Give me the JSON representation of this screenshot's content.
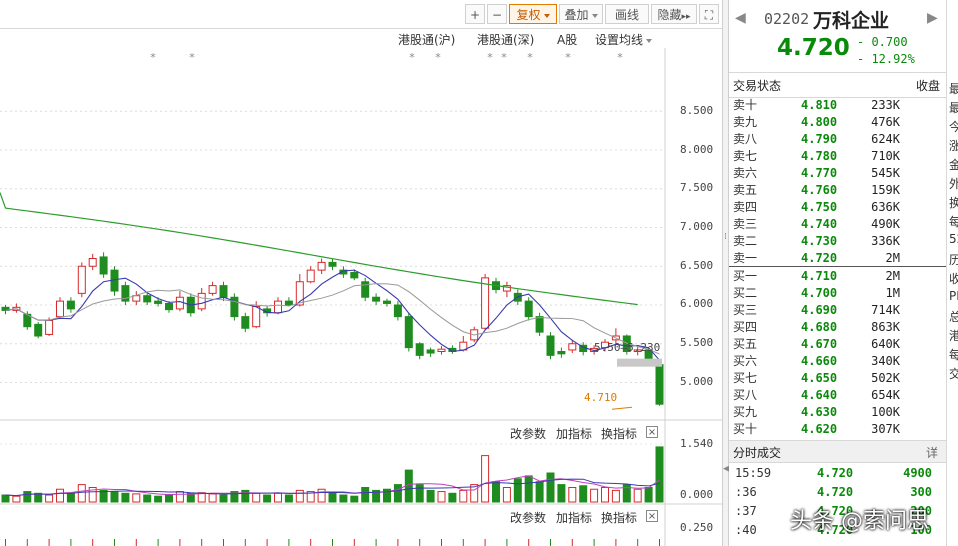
{
  "toolbar": {
    "plus": "+",
    "minus": "−",
    "adjust_label": "复权",
    "overlay_label": "叠加",
    "draw_label": "画线",
    "hide_label": "隐藏",
    "hide_arrows": "▸▸",
    "fullscreen": "⛶"
  },
  "subnav": {
    "items": [
      "港股通(沪)",
      "港股通(深)",
      "A股",
      "设置均线"
    ]
  },
  "price_axis": [
    "8.500",
    "8.000",
    "7.500",
    "7.000",
    "6.500",
    "6.000",
    "5.500",
    "5.000"
  ],
  "price_annotations": {
    "low_label": "4.710",
    "range_label": "5.50–5.230"
  },
  "volume_panel": {
    "buttons": [
      "改参数",
      "加指标",
      "换指标"
    ],
    "axis": [
      "1.540",
      "0.000"
    ]
  },
  "indicator_panel": {
    "buttons": [
      "改参数",
      "加指标",
      "换指标"
    ],
    "axis": [
      "0.250"
    ]
  },
  "close_glyph": "×",
  "quote": {
    "code": "02202",
    "name": "万科企业",
    "price": "4.720",
    "change": "- 0.700",
    "change_pct": "- 12.92%",
    "prev_arrow": "◀",
    "next_arrow": "▶"
  },
  "trade_status": {
    "label": "交易状态",
    "value": "收盘"
  },
  "order_book": {
    "asks": [
      {
        "label": "卖十",
        "price": "4.810",
        "volume": "233K"
      },
      {
        "label": "卖九",
        "price": "4.800",
        "volume": "476K"
      },
      {
        "label": "卖八",
        "price": "4.790",
        "volume": "624K"
      },
      {
        "label": "卖七",
        "price": "4.780",
        "volume": "710K"
      },
      {
        "label": "卖六",
        "price": "4.770",
        "volume": "545K"
      },
      {
        "label": "卖五",
        "price": "4.760",
        "volume": "159K"
      },
      {
        "label": "卖四",
        "price": "4.750",
        "volume": "636K"
      },
      {
        "label": "卖三",
        "price": "4.740",
        "volume": "490K"
      },
      {
        "label": "卖二",
        "price": "4.730",
        "volume": "336K"
      },
      {
        "label": "卖一",
        "price": "4.720",
        "volume": "2M"
      }
    ],
    "bids": [
      {
        "label": "买一",
        "price": "4.710",
        "volume": "2M"
      },
      {
        "label": "买二",
        "price": "4.700",
        "volume": "1M"
      },
      {
        "label": "买三",
        "price": "4.690",
        "volume": "714K"
      },
      {
        "label": "买四",
        "price": "4.680",
        "volume": "863K"
      },
      {
        "label": "买五",
        "price": "4.670",
        "volume": "640K"
      },
      {
        "label": "买六",
        "price": "4.660",
        "volume": "340K"
      },
      {
        "label": "买七",
        "price": "4.650",
        "volume": "502K"
      },
      {
        "label": "买八",
        "price": "4.640",
        "volume": "654K"
      },
      {
        "label": "买九",
        "price": "4.630",
        "volume": "100K"
      },
      {
        "label": "买十",
        "price": "4.620",
        "volume": "307K"
      }
    ]
  },
  "ticks": {
    "label": "分时成交",
    "detail": "详",
    "rows": [
      {
        "time": "15:59",
        "price": "4.720",
        "volume": "4900"
      },
      {
        "time": ":36",
        "price": "4.720",
        "volume": "300"
      },
      {
        "time": ":37",
        "price": "4.720",
        "volume": "200"
      },
      {
        "time": ":40",
        "price": "4.720",
        "volume": "100"
      }
    ]
  },
  "far_panel_chars": [
    "最",
    "最",
    "今",
    "涨",
    "金",
    "外",
    "换",
    "每",
    "52",
    "历",
    "收",
    "PE",
    "总",
    "港",
    "每",
    "交"
  ],
  "watermark": "头条 @索问思",
  "colors": {
    "up": "#d62a2a",
    "down": "#1e8c1e",
    "ma_long": "#2a9d2a",
    "ma_short": "#3a3ab0",
    "ma_mid": "#999999"
  }
}
